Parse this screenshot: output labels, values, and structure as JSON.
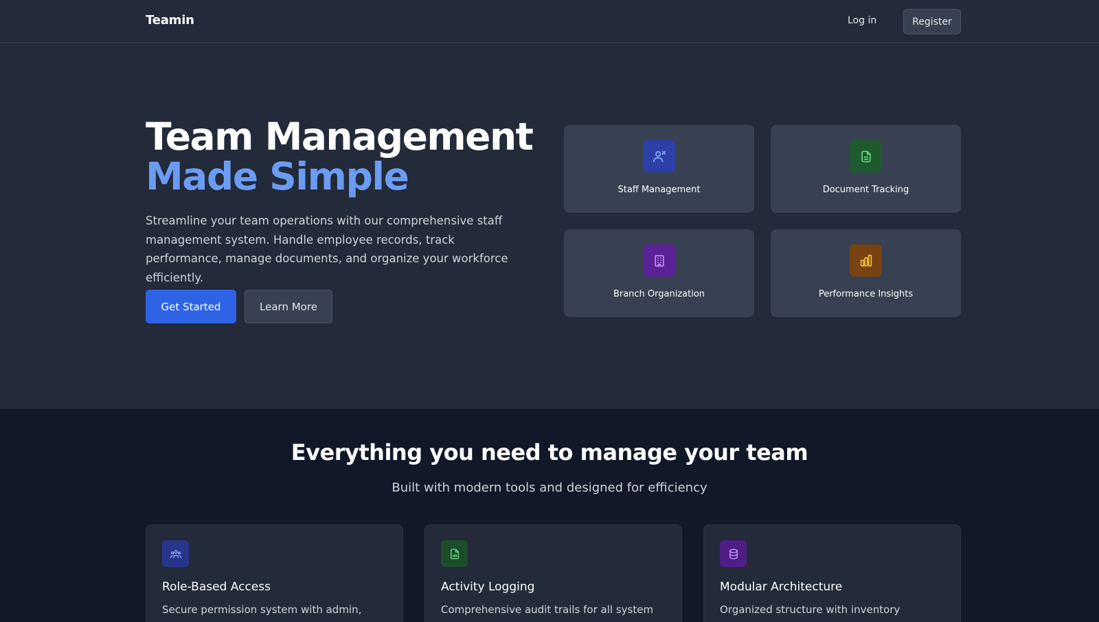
{
  "header": {
    "brand": "Teamin",
    "login_label": "Log in",
    "register_label": "Register"
  },
  "hero": {
    "title_line1": "Team Management",
    "title_line2": "Made Simple",
    "description": "Streamline your team operations with our comprehensive staff management system. Handle employee records, track performance, manage documents, and organize your workforce efficiently.",
    "primary_cta": "Get Started",
    "secondary_cta": "Learn More",
    "feature_cards": [
      {
        "label": "Staff Management",
        "icon": "staff-icon",
        "icon_bg": "#2e3fa8",
        "icon_color": "#8fb0ff"
      },
      {
        "label": "Document Tracking",
        "icon": "document-icon",
        "icon_bg": "#1f5a2f",
        "icon_color": "#6fe08a"
      },
      {
        "label": "Branch Organization",
        "icon": "building-icon",
        "icon_bg": "#5b2196",
        "icon_color": "#c79bff"
      },
      {
        "label": "Performance Insights",
        "icon": "bar-chart-icon",
        "icon_bg": "#7a4212",
        "icon_color": "#f8c23a"
      }
    ]
  },
  "features": {
    "title": "Everything you need to manage your team",
    "subtitle": "Built with modern tools and designed for efficiency",
    "items": [
      {
        "title": "Role-Based Access",
        "description": "Secure permission system with admin,",
        "icon": "users-group-icon",
        "icon_bg": "#27368c",
        "icon_color": "#8fb0ff"
      },
      {
        "title": "Activity Logging",
        "description": "Comprehensive audit trails for all system",
        "icon": "file-chart-icon",
        "icon_bg": "#1c4d2a",
        "icon_color": "#6fe08a"
      },
      {
        "title": "Modular Architecture",
        "description": "Organized structure with inventory",
        "icon": "database-icon",
        "icon_bg": "#4f1d85",
        "icon_color": "#c79bff"
      }
    ]
  },
  "colors": {
    "accent": "#2f63e6",
    "headline_accent": "#6b9cf2",
    "hero_bg": "#232a39",
    "section_bg": "#111827"
  }
}
